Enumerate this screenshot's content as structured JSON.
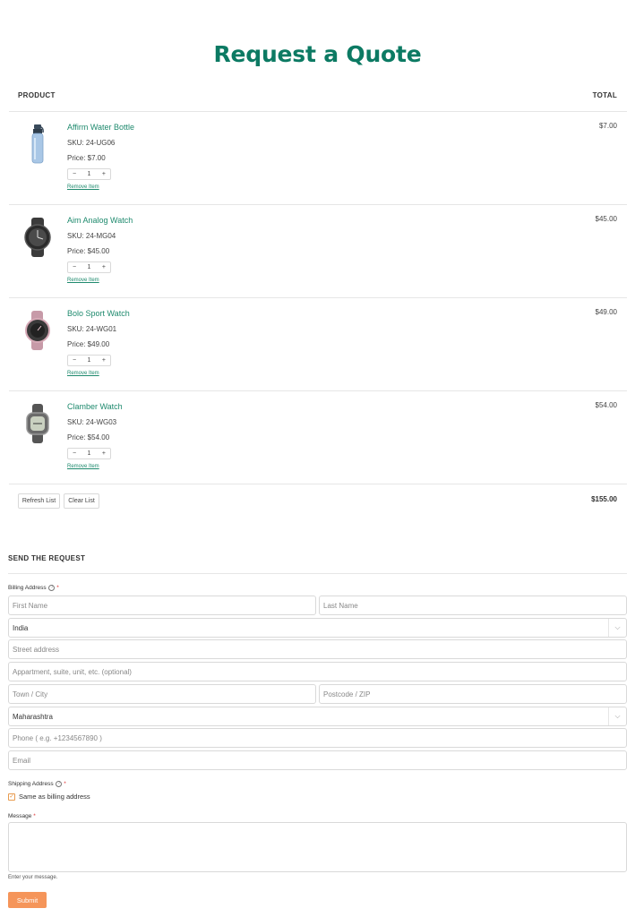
{
  "page": {
    "title": "Request a Quote"
  },
  "table": {
    "product_header": "PRODUCT",
    "total_header": "TOTAL",
    "items": [
      {
        "name": "Affirm Water Bottle",
        "sku": "SKU: 24-UG06",
        "price": "Price: $7.00",
        "qty": "1",
        "remove": "Remove Item",
        "total": "$7.00",
        "image": "water-bottle"
      },
      {
        "name": "Aim Analog Watch",
        "sku": "SKU: 24-MG04",
        "price": "Price: $45.00",
        "qty": "1",
        "remove": "Remove Item",
        "total": "$45.00",
        "image": "analog-watch"
      },
      {
        "name": "Bolo Sport Watch",
        "sku": "SKU: 24-WG01",
        "price": "Price: $49.00",
        "qty": "1",
        "remove": "Remove Item",
        "total": "$49.00",
        "image": "sport-watch"
      },
      {
        "name": "Clamber Watch",
        "sku": "SKU: 24-WG03",
        "price": "Price: $54.00",
        "qty": "1",
        "remove": "Remove Item",
        "total": "$54.00",
        "image": "clamber-watch"
      }
    ],
    "qty_minus": "−",
    "qty_plus": "+",
    "refresh_label": "Refresh List",
    "clear_label": "Clear List",
    "grand_total": "$155.00"
  },
  "form": {
    "section_title": "SEND THE REQUEST",
    "billing_label": "Billing Address",
    "help_glyph": "?",
    "required_mark": "*",
    "first_name_placeholder": "First Name",
    "last_name_placeholder": "Last Name",
    "country_value": "India",
    "street_placeholder": "Street address",
    "apartment_placeholder": "Appartment, suite, unit, etc. (optional)",
    "city_placeholder": "Town / City",
    "postcode_placeholder": "Postcode / ZIP",
    "state_value": "Maharashtra",
    "phone_placeholder": "Phone ( e.g. +1234567890 )",
    "email_placeholder": "Email",
    "shipping_label": "Shipping Address",
    "same_as_billing": "Same as billing address",
    "checkbox_glyph": "✓",
    "message_label": "Message",
    "message_help": "Enter your message.",
    "submit_label": "Submit",
    "select_arrow": "⌵"
  },
  "colors": {
    "accent": "#0c7a63",
    "link": "#1f8a6e",
    "submit": "#f5955a"
  }
}
